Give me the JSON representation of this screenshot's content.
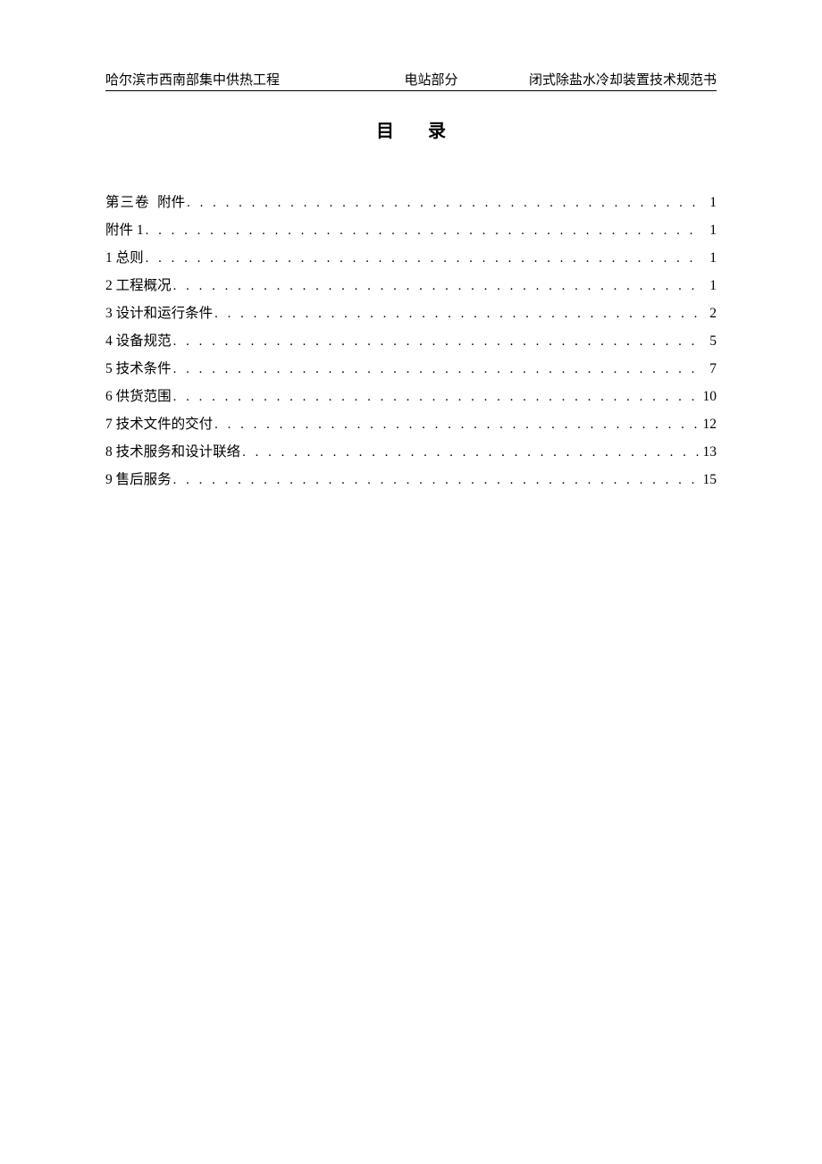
{
  "header": {
    "left": "哈尔滨市西南部集中供热工程",
    "center": "电站部分",
    "right": "闭式除盐水冷却装置技术规范书"
  },
  "title": "目录",
  "toc": [
    {
      "label": "第三卷",
      "spacer": true,
      "sublabel": "附件",
      "page": "1",
      "vol": true
    },
    {
      "label": "附件 1",
      "page": "1"
    },
    {
      "label": "1 总则",
      "page": "1"
    },
    {
      "label": "2 工程概况",
      "page": "1"
    },
    {
      "label": "3 设计和运行条件",
      "page": "2"
    },
    {
      "label": "4 设备规范",
      "page": "5"
    },
    {
      "label": "5 技术条件",
      "page": "7"
    },
    {
      "label": "6 供货范围",
      "page": "10"
    },
    {
      "label": "7 技术文件的交付",
      "page": "12"
    },
    {
      "label": "8 技术服务和设计联络",
      "page": "13"
    },
    {
      "label": "9 售后服务",
      "page": "15"
    }
  ]
}
